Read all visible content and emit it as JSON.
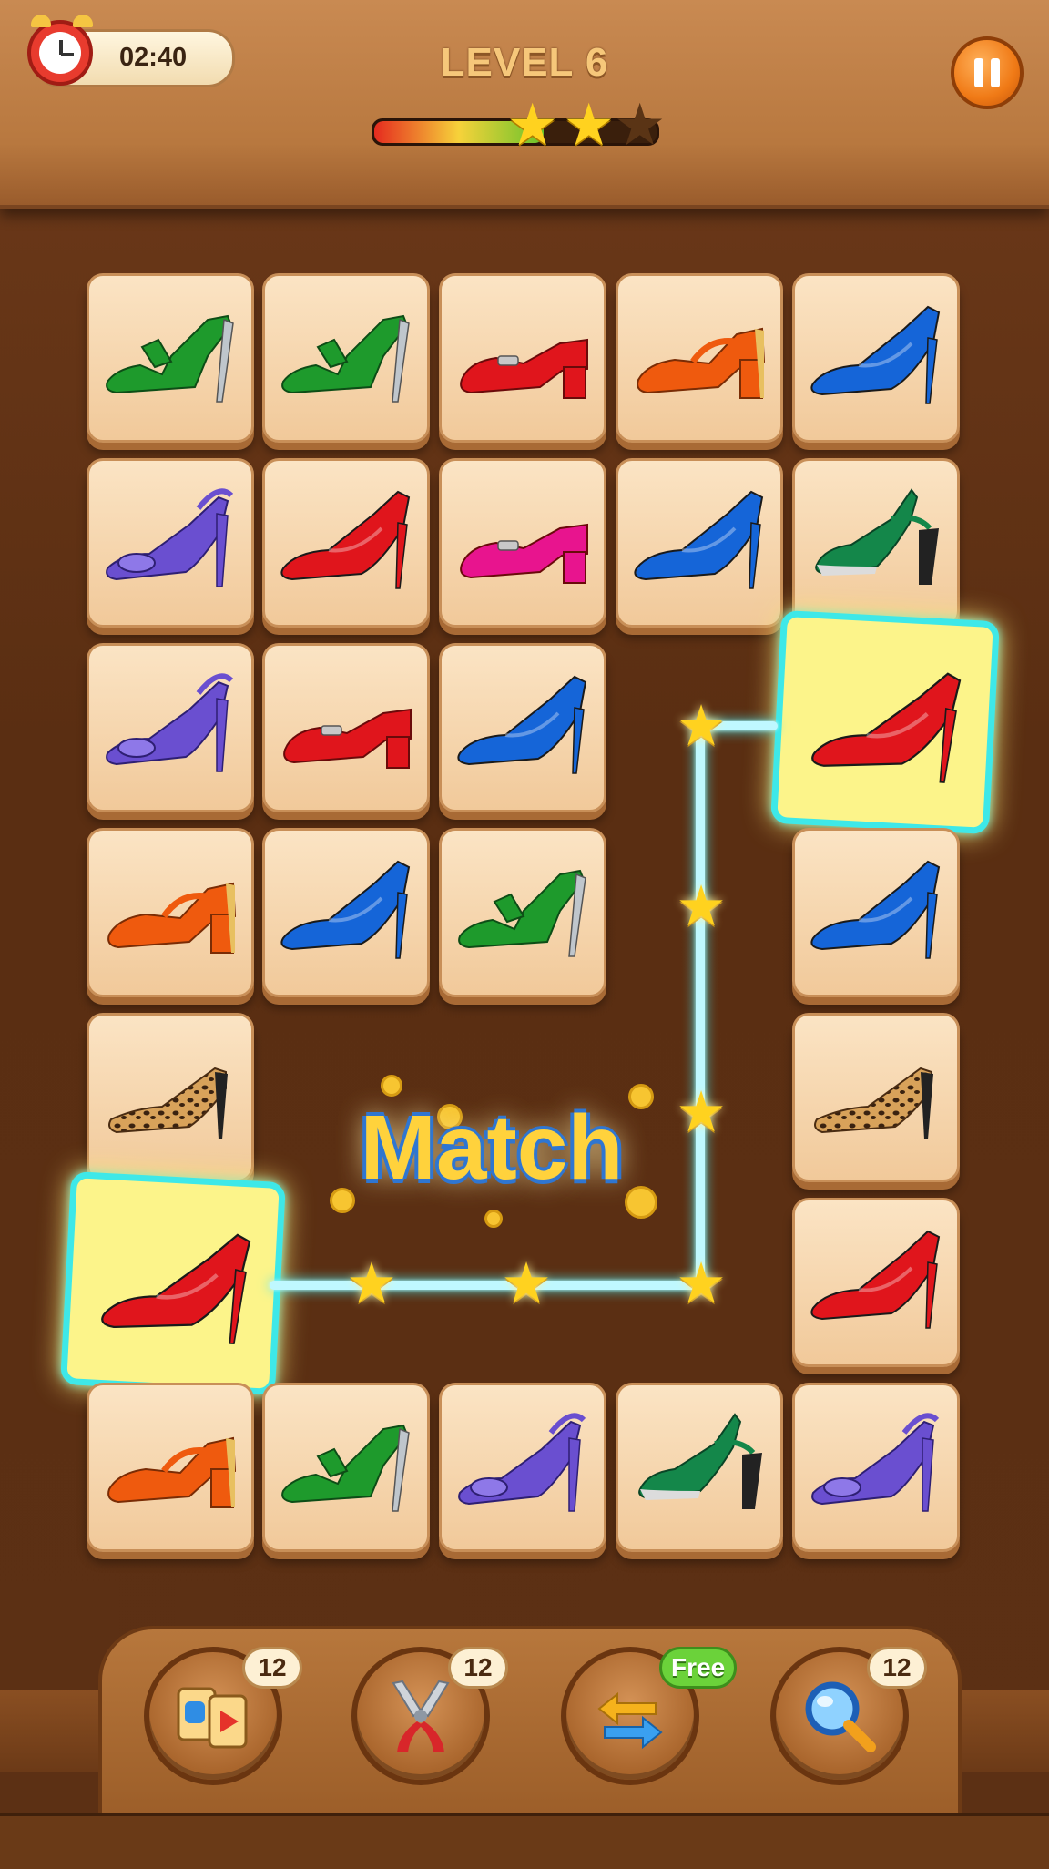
{
  "hud": {
    "timer": "02:40",
    "level": "LEVEL 6",
    "progress": 0.6,
    "stars_earned": 2,
    "stars_total": 3,
    "pause_icon": "pause-icon"
  },
  "board": {
    "tiles": [
      {
        "shoe": "green-strappy-heel",
        "color": "#1e9a2c",
        "row": 1,
        "col": 1
      },
      {
        "shoe": "green-strappy-heel",
        "color": "#1e9a2c",
        "row": 1,
        "col": 2
      },
      {
        "shoe": "red-block-pump",
        "color": "#e0151c",
        "row": 1,
        "col": 3
      },
      {
        "shoe": "orange-mary-jane",
        "color": "#ef5a0e",
        "row": 1,
        "col": 4
      },
      {
        "shoe": "blue-stiletto",
        "color": "#1565d8",
        "row": 1,
        "col": 5
      },
      {
        "shoe": "purple-ankle-strap",
        "color": "#6a4fd0",
        "row": 2,
        "col": 1
      },
      {
        "shoe": "red-stiletto",
        "color": "#e0151c",
        "row": 2,
        "col": 2
      },
      {
        "shoe": "pink-block-pump",
        "color": "#e8148e",
        "row": 2,
        "col": 3
      },
      {
        "shoe": "blue-stiletto",
        "color": "#1565d8",
        "row": 2,
        "col": 4
      },
      {
        "shoe": "green-slingback",
        "color": "#14874a",
        "row": 2,
        "col": 5
      },
      {
        "shoe": "purple-ankle-strap",
        "color": "#6a4fd0",
        "row": 3,
        "col": 1
      },
      {
        "shoe": "red-block-pump",
        "color": "#e0151c",
        "row": 3,
        "col": 2
      },
      {
        "shoe": "blue-stiletto",
        "color": "#1565d8",
        "row": 3,
        "col": 3
      },
      {
        "shoe": "red-stiletto",
        "color": "#e0151c",
        "row": 3,
        "col": 5,
        "selected": true
      },
      {
        "shoe": "orange-mary-jane",
        "color": "#ef5a0e",
        "row": 4,
        "col": 1
      },
      {
        "shoe": "blue-stiletto",
        "color": "#1565d8",
        "row": 4,
        "col": 2
      },
      {
        "shoe": "green-strappy-heel",
        "color": "#1e9a2c",
        "row": 4,
        "col": 3
      },
      {
        "shoe": "blue-stiletto",
        "color": "#1565d8",
        "row": 4,
        "col": 5
      },
      {
        "shoe": "leopard-pump",
        "color": "#b0783a",
        "row": 5,
        "col": 1
      },
      {
        "shoe": "leopard-pump",
        "color": "#b0783a",
        "row": 5,
        "col": 5
      },
      {
        "shoe": "red-stiletto",
        "color": "#e0151c",
        "row": 6,
        "col": 1,
        "selected": true
      },
      {
        "shoe": "red-stiletto",
        "color": "#e0151c",
        "row": 6,
        "col": 5
      },
      {
        "shoe": "orange-mary-jane",
        "color": "#ef5a0e",
        "row": 7,
        "col": 1
      },
      {
        "shoe": "green-strappy-heel",
        "color": "#1e9a2c",
        "row": 7,
        "col": 2
      },
      {
        "shoe": "purple-ankle-strap",
        "color": "#6a4fd0",
        "row": 7,
        "col": 3
      },
      {
        "shoe": "green-slingback",
        "color": "#14874a",
        "row": 7,
        "col": 4
      },
      {
        "shoe": "purple-ankle-strap",
        "color": "#6a4fd0",
        "row": 7,
        "col": 5
      }
    ],
    "match_text": "Match"
  },
  "boosters": [
    {
      "name": "swap-cards",
      "icon": "cards-icon",
      "badge": "12"
    },
    {
      "name": "remove-pair",
      "icon": "pliers-icon",
      "badge": "12"
    },
    {
      "name": "shuffle",
      "icon": "shuffle-arrows-icon",
      "badge": "Free"
    },
    {
      "name": "hint",
      "icon": "magnifier-icon",
      "badge": "12"
    }
  ]
}
